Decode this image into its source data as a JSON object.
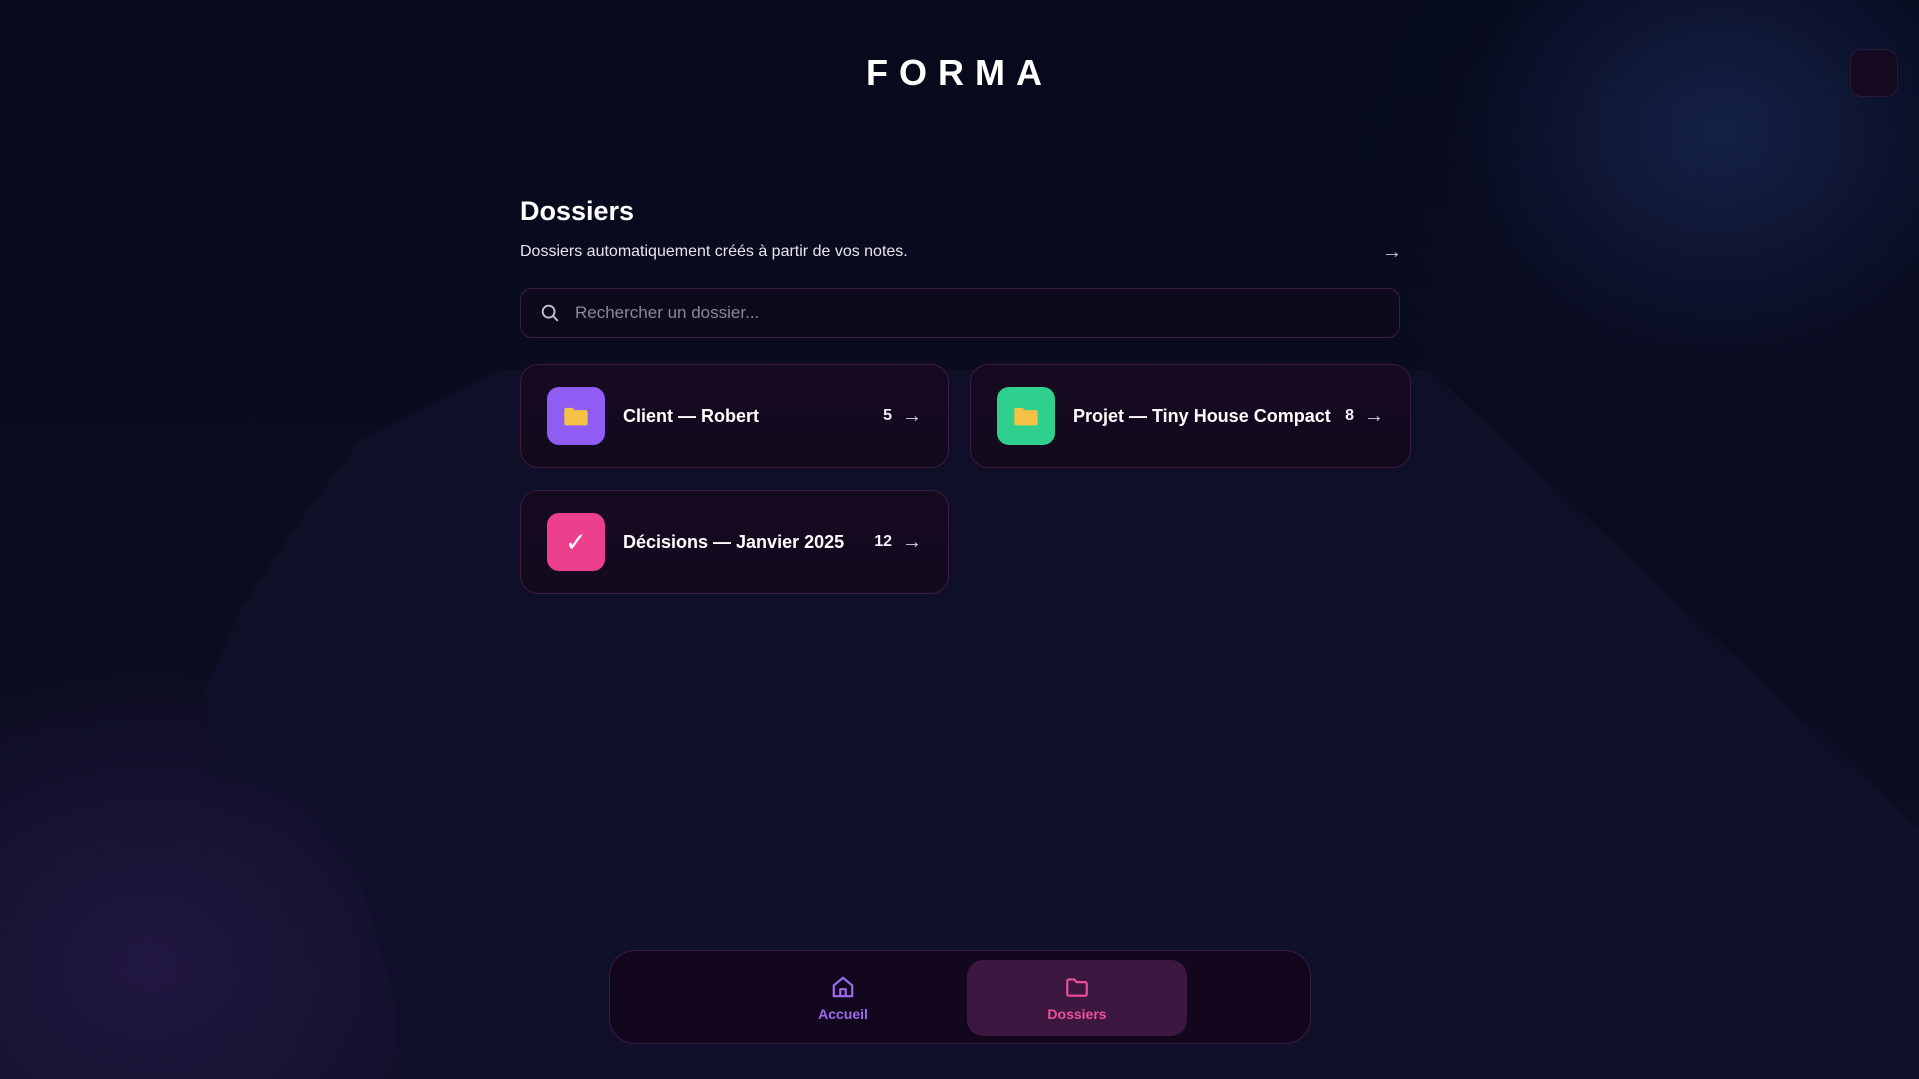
{
  "app": {
    "brand": "FORMA"
  },
  "header": {
    "title": "Dossiers",
    "subtitle": "Dossiers automatiquement créés à partir de vos notes.",
    "arrow": "→"
  },
  "search": {
    "placeholder": "Rechercher un dossier...",
    "value": ""
  },
  "folders": [
    {
      "name": "Client — Robert",
      "count": "5",
      "arrow": "→",
      "icon": "folder-icon",
      "color": "#8f5cf4",
      "glyph_color": "#f6c246"
    },
    {
      "name": "Projet — Tiny House Compact",
      "count": "8",
      "arrow": "→",
      "icon": "folder-icon",
      "color": "#2fcf8e",
      "glyph_color": "#f6c246"
    },
    {
      "name": "Décisions — Janvier 2025",
      "count": "12",
      "arrow": "→",
      "icon": "check-icon",
      "glyph": "✓",
      "color": "#ec3f8e"
    }
  ],
  "nav": {
    "items": [
      {
        "label": "Accueil",
        "icon": "home-icon",
        "color": "#9b6cf0",
        "active": false
      },
      {
        "label": "Dossiers",
        "icon": "folder-outline-icon",
        "color": "#ee4f9b",
        "active": true
      }
    ]
  },
  "colors": {
    "background": "#0a0b1c",
    "card_border": "#3d1b40",
    "active_nav_bg": "#3c1840"
  }
}
